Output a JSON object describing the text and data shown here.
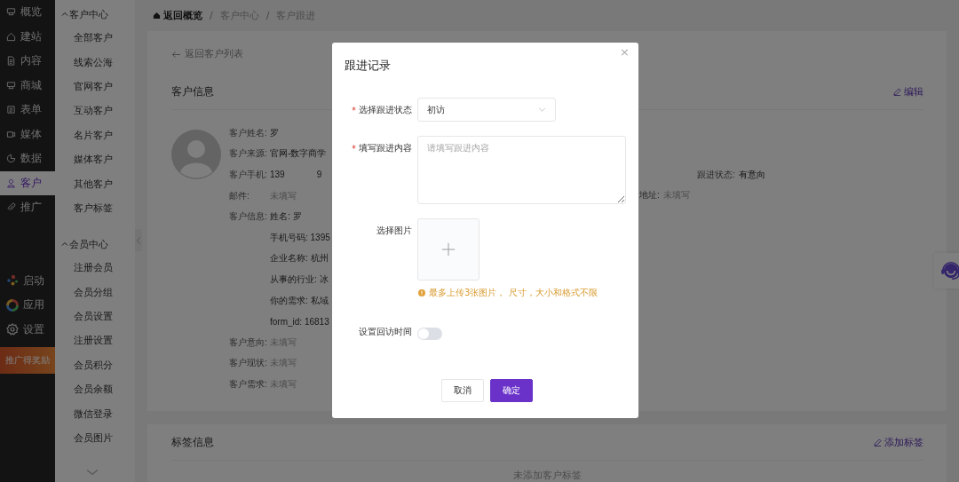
{
  "sidebar": {
    "items": [
      {
        "label": "概览",
        "selected": false
      },
      {
        "label": "建站",
        "selected": false
      },
      {
        "label": "内容",
        "selected": false
      },
      {
        "label": "商城",
        "selected": false
      },
      {
        "label": "表单",
        "selected": false
      },
      {
        "label": "媒体",
        "selected": false
      },
      {
        "label": "数据",
        "selected": false
      },
      {
        "label": "客户",
        "selected": true
      },
      {
        "label": "推广",
        "selected": false
      }
    ],
    "bottom_items": [
      {
        "label": "启动"
      },
      {
        "label": "应用"
      },
      {
        "label": "设置"
      }
    ],
    "promo": "推广得奖励"
  },
  "submenu": {
    "groups": [
      {
        "title": "客户中心",
        "expanded": true,
        "items": [
          "全部客户",
          "线索公海",
          "官网客户",
          "互动客户",
          "名片客户",
          "媒体客户",
          "其他客户",
          "客户标签"
        ]
      },
      {
        "title": "会员中心",
        "expanded": true,
        "items": [
          "注册会员",
          "会员分组",
          "会员设置",
          "注册设置",
          "会员积分",
          "会员余额",
          "微信登录",
          "会员图片"
        ]
      }
    ]
  },
  "breadcrumb": [
    {
      "label": "返回概览",
      "selected": true
    },
    {
      "label": "客户中心",
      "selected": false
    },
    {
      "label": "客户跟进",
      "selected": false
    }
  ],
  "breadcrumb_separator": "/",
  "back_link": "返回客户列表",
  "customer_card": {
    "title": "客户信息",
    "edit": "编辑",
    "fields": [
      {
        "label": "客户姓名:",
        "value": "罗",
        "muted": false
      },
      {
        "label": "客户来源:",
        "value": "官网-数字商学",
        "muted": false
      },
      {
        "label": "客户手机:",
        "value": "139",
        "value_end": "9",
        "muted": false
      },
      {
        "label": "邮件:",
        "value": "未填写",
        "muted": true
      }
    ],
    "info_label": "客户信息:",
    "info_lines": [
      "姓名: 罗",
      "手机号码: 1395",
      "企业名称: 杭州",
      "从事的行业: 冰",
      "你的需求: 私域",
      "form_id: 16813"
    ],
    "more_fields": [
      {
        "label": "客户意向:",
        "value": "未填写",
        "muted": true
      },
      {
        "label": "客户现状:",
        "value": "未填写",
        "muted": true
      },
      {
        "label": "客户需求:",
        "value": "未填写",
        "muted": true
      }
    ],
    "side_fields": [
      {
        "label": "跟进状态:",
        "value": "有意向",
        "muted": false
      },
      {
        "label": "地址:",
        "value": "未填写",
        "muted": true
      }
    ]
  },
  "tag_card": {
    "title": "标签信息",
    "add": "添加标签",
    "empty": "未添加客户标签"
  },
  "dialog": {
    "title": "跟进记录",
    "close": "×",
    "status": {
      "label": "选择跟进状态",
      "required": true,
      "value": "初访"
    },
    "content": {
      "label": "填写跟进内容",
      "required": true,
      "placeholder": "请填写跟进内容"
    },
    "image": {
      "label": "选择图片",
      "hint": "最多上传3张图片， 尺寸，大小和格式不限"
    },
    "revisit": {
      "label": "设置回访时间",
      "on": false
    },
    "buttons": [
      {
        "label": "取消",
        "kind": "default"
      },
      {
        "label": "确定",
        "kind": "primary"
      }
    ]
  }
}
